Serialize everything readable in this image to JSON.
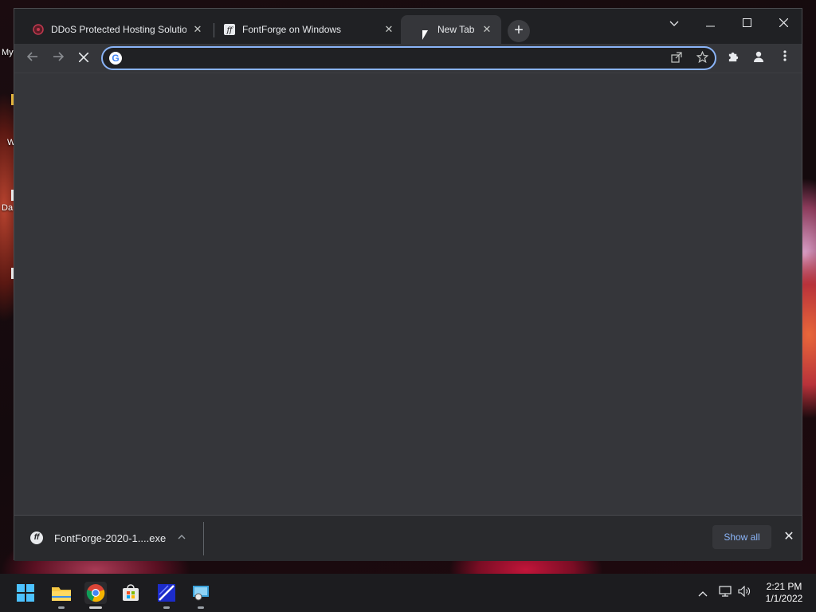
{
  "desktop": {
    "labels": [
      "My",
      "W",
      "Da"
    ]
  },
  "browser": {
    "tabs": [
      {
        "title": "DDoS Protected Hosting Solution",
        "icon": "ddos-favicon",
        "active": false
      },
      {
        "title": "FontForge on Windows",
        "icon": "fontforge-favicon",
        "active": false
      },
      {
        "title": "New Tab",
        "icon": "none",
        "active": true
      }
    ],
    "new_tab_glyph": "+",
    "window_controls": {
      "tab_search": "⌄",
      "minimize": "—",
      "maximize": "☐",
      "close": "✕"
    },
    "nav": {
      "back": "←",
      "forward": "→",
      "stop": "✕"
    },
    "omnibox": {
      "value": "",
      "placeholder": "",
      "g_icon": "G",
      "share_icon": "share-icon",
      "star_icon": "star-icon"
    },
    "toolbar_icons": {
      "extensions": "puzzle-icon",
      "profile": "profile-icon",
      "menu": "kebab-menu-icon"
    },
    "accent": "#8ab4f8"
  },
  "download_shelf": {
    "file_name": "FontForge-2020-1....exe",
    "show_all_label": "Show all",
    "close_glyph": "✕"
  },
  "taskbar": {
    "apps": [
      "start-icon",
      "file-explorer-icon",
      "chrome-icon",
      "store-icon",
      "fontforge-app-icon",
      "network-app-icon"
    ],
    "clock": {
      "time": "2:21 PM",
      "date": "1/1/2022"
    }
  }
}
